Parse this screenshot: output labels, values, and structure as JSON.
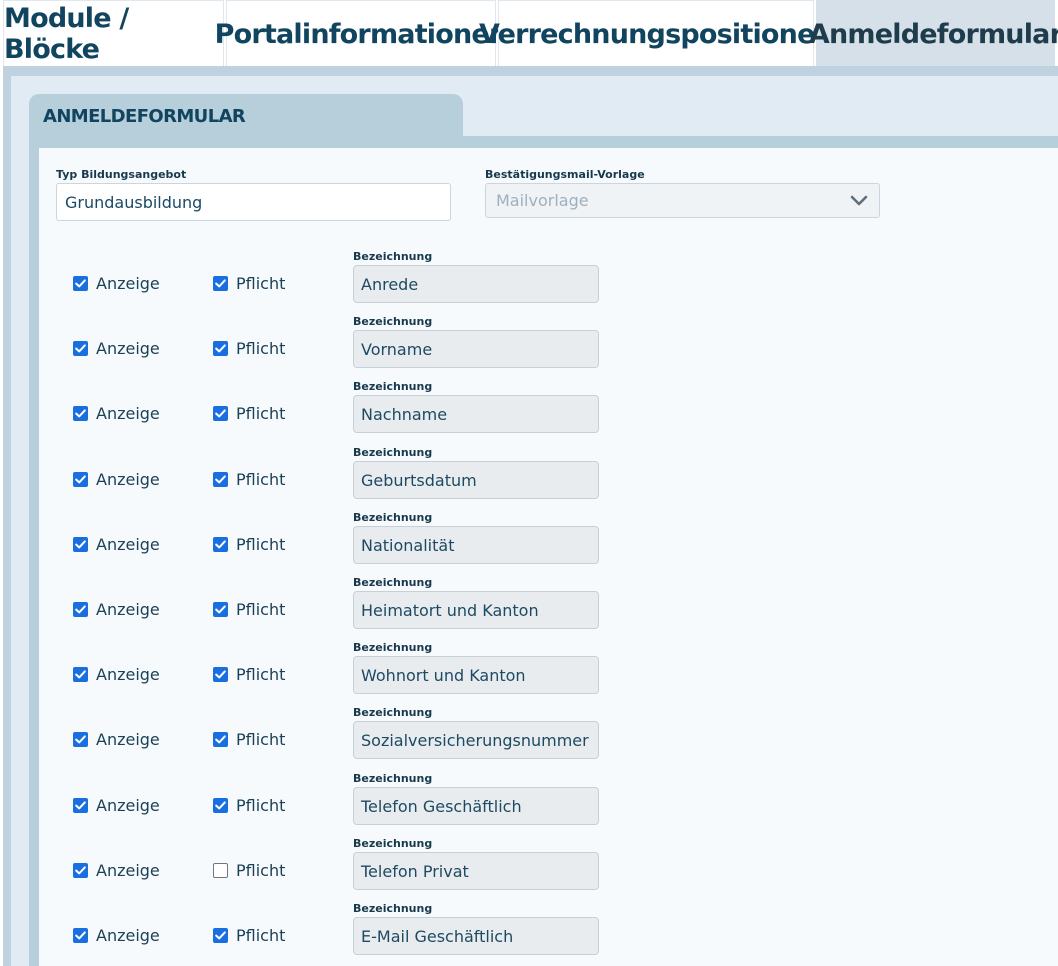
{
  "tabs": [
    {
      "label": "Module / Blöcke",
      "active": false
    },
    {
      "label": "Portalinformationen",
      "active": false
    },
    {
      "label": "Verrechnungspositionen",
      "active": false
    },
    {
      "label": "Anmeldeformular",
      "active": true
    }
  ],
  "section": {
    "title": "ANMELDEFORMULAR"
  },
  "form": {
    "typ_label": "Typ Bildungsangebot",
    "typ_value": "Grundausbildung",
    "mail_label": "Bestätigungsmail-Vorlage",
    "mail_placeholder": "Mailvorlage"
  },
  "fields": [
    {
      "anzeige_label": "Anzeige",
      "anzeige": true,
      "pflicht_label": "Pflicht",
      "pflicht": true,
      "bez_label": "Bezeichnung",
      "bezeichnung": "Anrede"
    },
    {
      "anzeige_label": "Anzeige",
      "anzeige": true,
      "pflicht_label": "Pflicht",
      "pflicht": true,
      "bez_label": "Bezeichnung",
      "bezeichnung": "Vorname"
    },
    {
      "anzeige_label": "Anzeige",
      "anzeige": true,
      "pflicht_label": "Pflicht",
      "pflicht": true,
      "bez_label": "Bezeichnung",
      "bezeichnung": "Nachname"
    },
    {
      "anzeige_label": "Anzeige",
      "anzeige": true,
      "pflicht_label": "Pflicht",
      "pflicht": true,
      "bez_label": "Bezeichnung",
      "bezeichnung": "Geburtsdatum"
    },
    {
      "anzeige_label": "Anzeige",
      "anzeige": true,
      "pflicht_label": "Pflicht",
      "pflicht": true,
      "bez_label": "Bezeichnung",
      "bezeichnung": "Nationalität"
    },
    {
      "anzeige_label": "Anzeige",
      "anzeige": true,
      "pflicht_label": "Pflicht",
      "pflicht": true,
      "bez_label": "Bezeichnung",
      "bezeichnung": "Heimatort und Kanton"
    },
    {
      "anzeige_label": "Anzeige",
      "anzeige": true,
      "pflicht_label": "Pflicht",
      "pflicht": true,
      "bez_label": "Bezeichnung",
      "bezeichnung": "Wohnort und Kanton"
    },
    {
      "anzeige_label": "Anzeige",
      "anzeige": true,
      "pflicht_label": "Pflicht",
      "pflicht": true,
      "bez_label": "Bezeichnung",
      "bezeichnung": "Sozialversicherungsnummer"
    },
    {
      "anzeige_label": "Anzeige",
      "anzeige": true,
      "pflicht_label": "Pflicht",
      "pflicht": true,
      "bez_label": "Bezeichnung",
      "bezeichnung": "Telefon Geschäftlich"
    },
    {
      "anzeige_label": "Anzeige",
      "anzeige": true,
      "pflicht_label": "Pflicht",
      "pflicht": false,
      "bez_label": "Bezeichnung",
      "bezeichnung": "Telefon Privat"
    },
    {
      "anzeige_label": "Anzeige",
      "anzeige": true,
      "pflicht_label": "Pflicht",
      "pflicht": true,
      "bez_label": "Bezeichnung",
      "bezeichnung": "E-Mail Geschäftlich"
    }
  ],
  "colors": {
    "checkbox_checked": "#1a6fe0",
    "heading": "#10445f",
    "panel": "#b7cedb"
  }
}
